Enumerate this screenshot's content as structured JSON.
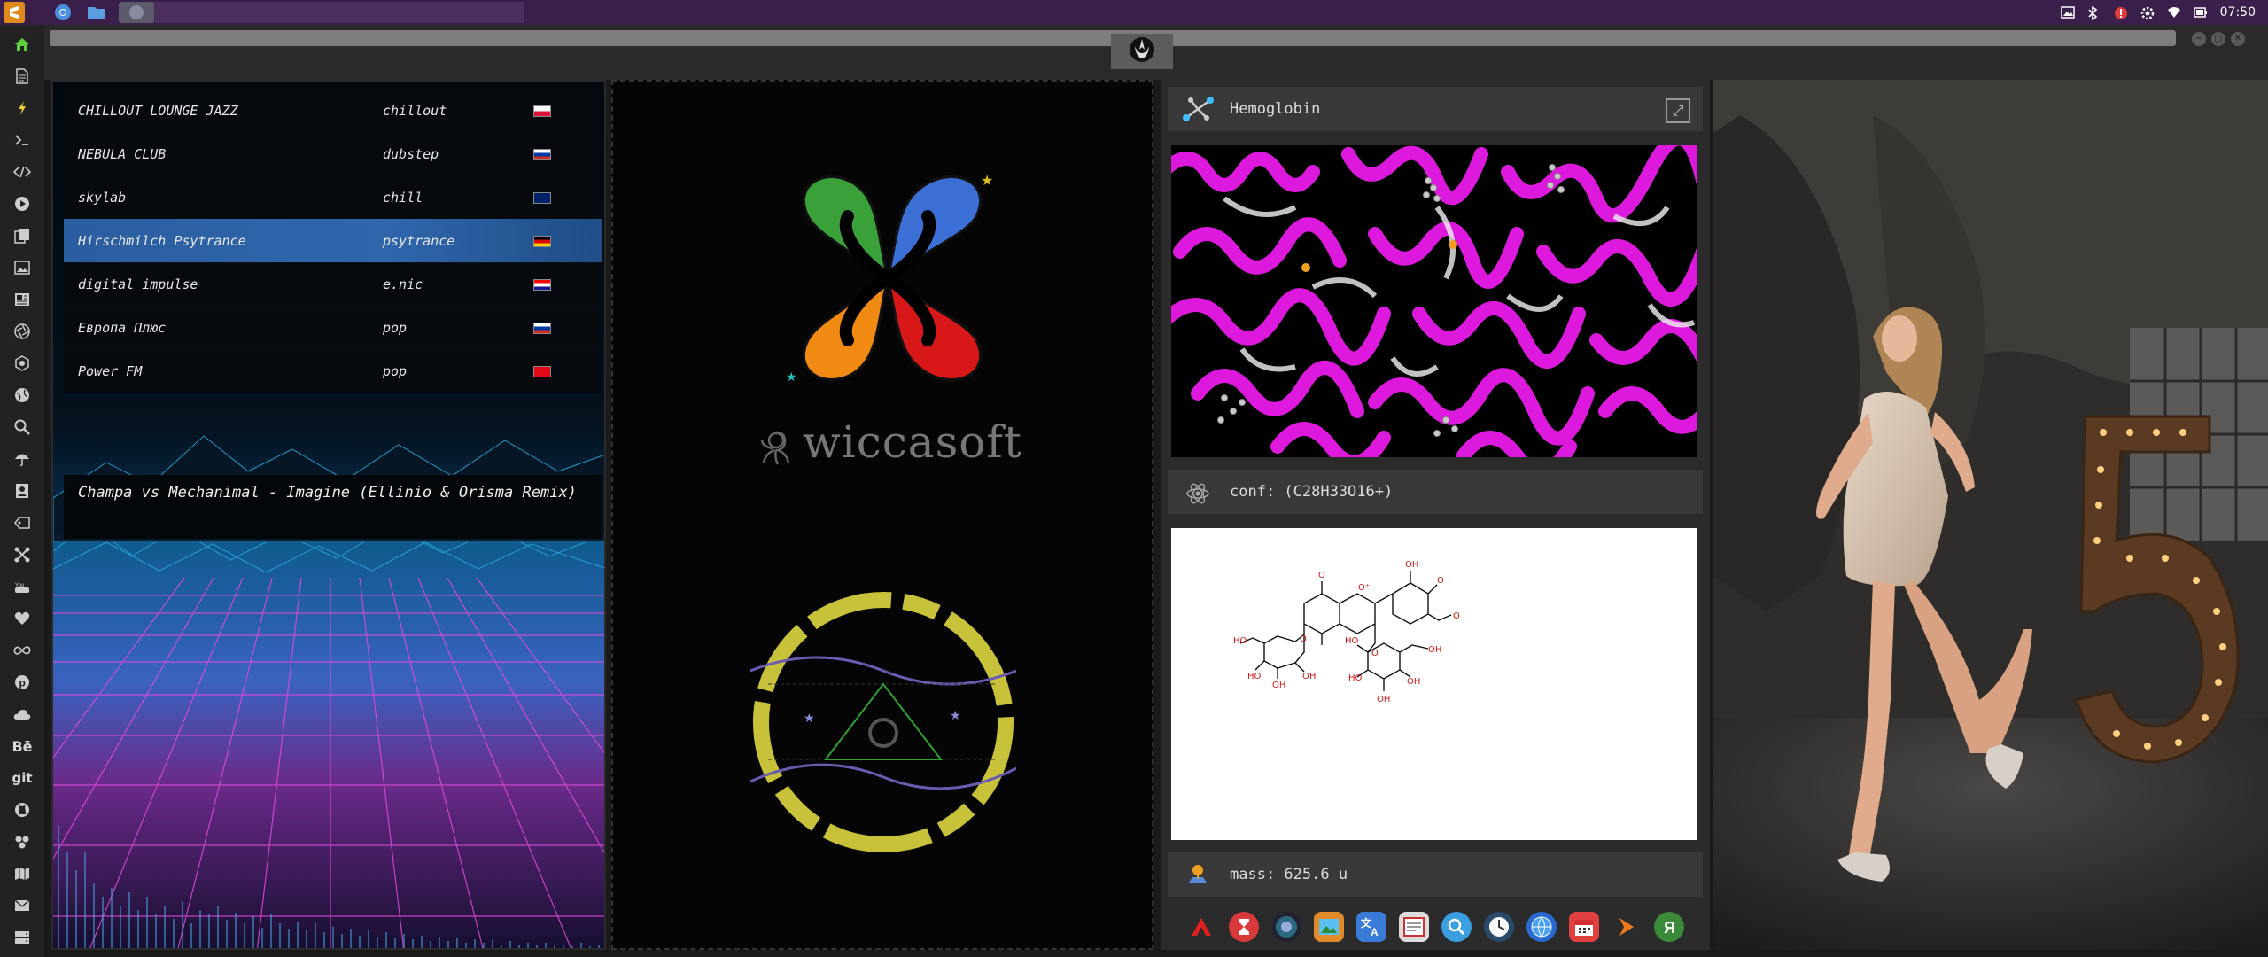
{
  "topbar": {
    "time": "07:50"
  },
  "chrome": {
    "tab_icon": "rebel-alliance-icon"
  },
  "radio": {
    "stations": [
      {
        "name": "CHILLOUT LOUNGE JAZZ",
        "genre": "chillout",
        "flag": "pl"
      },
      {
        "name": "NEBULA CLUB",
        "genre": "dubstep",
        "flag": "ru"
      },
      {
        "name": "skylab",
        "genre": "chill",
        "flag": "gb"
      },
      {
        "name": "Hirschmilch Psytrance",
        "genre": "psytrance",
        "flag": "de",
        "selected": true
      },
      {
        "name": "digital impulse",
        "genre": "e.nic",
        "flag": "hr"
      },
      {
        "name": "Европа Плюс",
        "genre": "pop",
        "flag": "ru"
      },
      {
        "name": "Power FM",
        "genre": "pop",
        "flag": "tr"
      }
    ],
    "now_playing": "Champa vs Mechanimal - Imagine (Ellinio & Orisma Remix)"
  },
  "brand": {
    "name": "wiccasoft"
  },
  "molecule": {
    "title": "Hemoglobin",
    "conf": "conf: (C28H33O16+)",
    "mass": "mass: 625.6 u"
  },
  "colors": {
    "accent_purple": "#3a1f4a",
    "selected_row": "#2f66ac",
    "protein": "#e81be8",
    "logo_green": "#3aa13a",
    "logo_blue": "#3b6fd6",
    "logo_orange": "#f08a12",
    "logo_red": "#d81818",
    "ring_yellow": "#c8c23a"
  },
  "dock": {
    "apps": [
      "adobe-icon",
      "hourglass-icon",
      "orb-icon",
      "photos-icon",
      "translate-icon",
      "notes-icon",
      "search-icon",
      "clock-icon",
      "globe-icon",
      "calendar-icon",
      "arrow-icon",
      "yandex-icon"
    ]
  }
}
